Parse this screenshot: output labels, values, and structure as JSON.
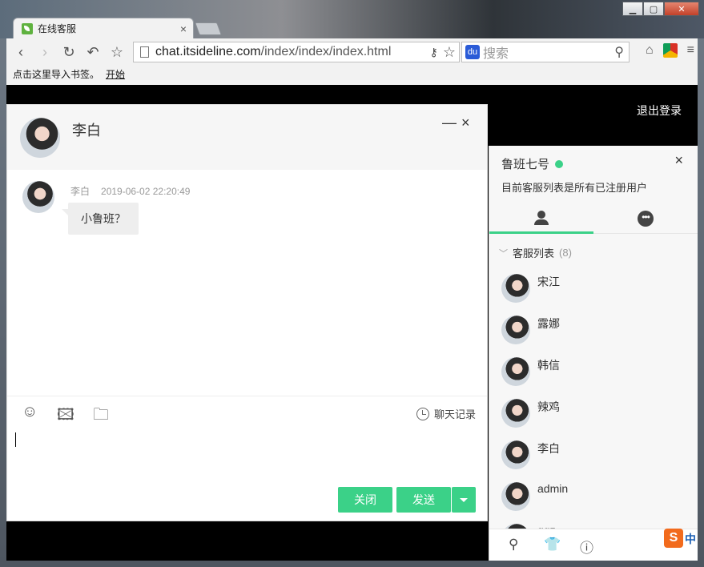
{
  "browser": {
    "tab_title": "在线客服",
    "tab_close": "×",
    "url_host": "chat.itsideline.com",
    "url_path": "/index/index/index.html",
    "search_placeholder": "搜索",
    "bookmark_hint": "点击这里导入书签。",
    "bookmark_start": "开始"
  },
  "page": {
    "logout_label": "退出登录"
  },
  "chat": {
    "peer_name": "李白",
    "minimize_glyph": "—",
    "close_glyph": "×",
    "messages": [
      {
        "sender": "李白",
        "time": "2019-06-02 22:20:49",
        "text": "小鲁班？"
      }
    ],
    "history_label": "聊天记录",
    "close_button": "关闭",
    "send_button": "发送"
  },
  "panel": {
    "username": "鲁班七号",
    "signature": "目前客服列表是所有已注册用户",
    "close_glyph": "×",
    "group_name": "客服列表",
    "group_count": "(8)",
    "contacts": [
      "宋江",
      "露娜",
      "韩信",
      "辣鸡",
      "李白",
      "admin",
      "ggz"
    ]
  },
  "colors": {
    "accent": "#3bd188",
    "online": "#3bd188"
  }
}
